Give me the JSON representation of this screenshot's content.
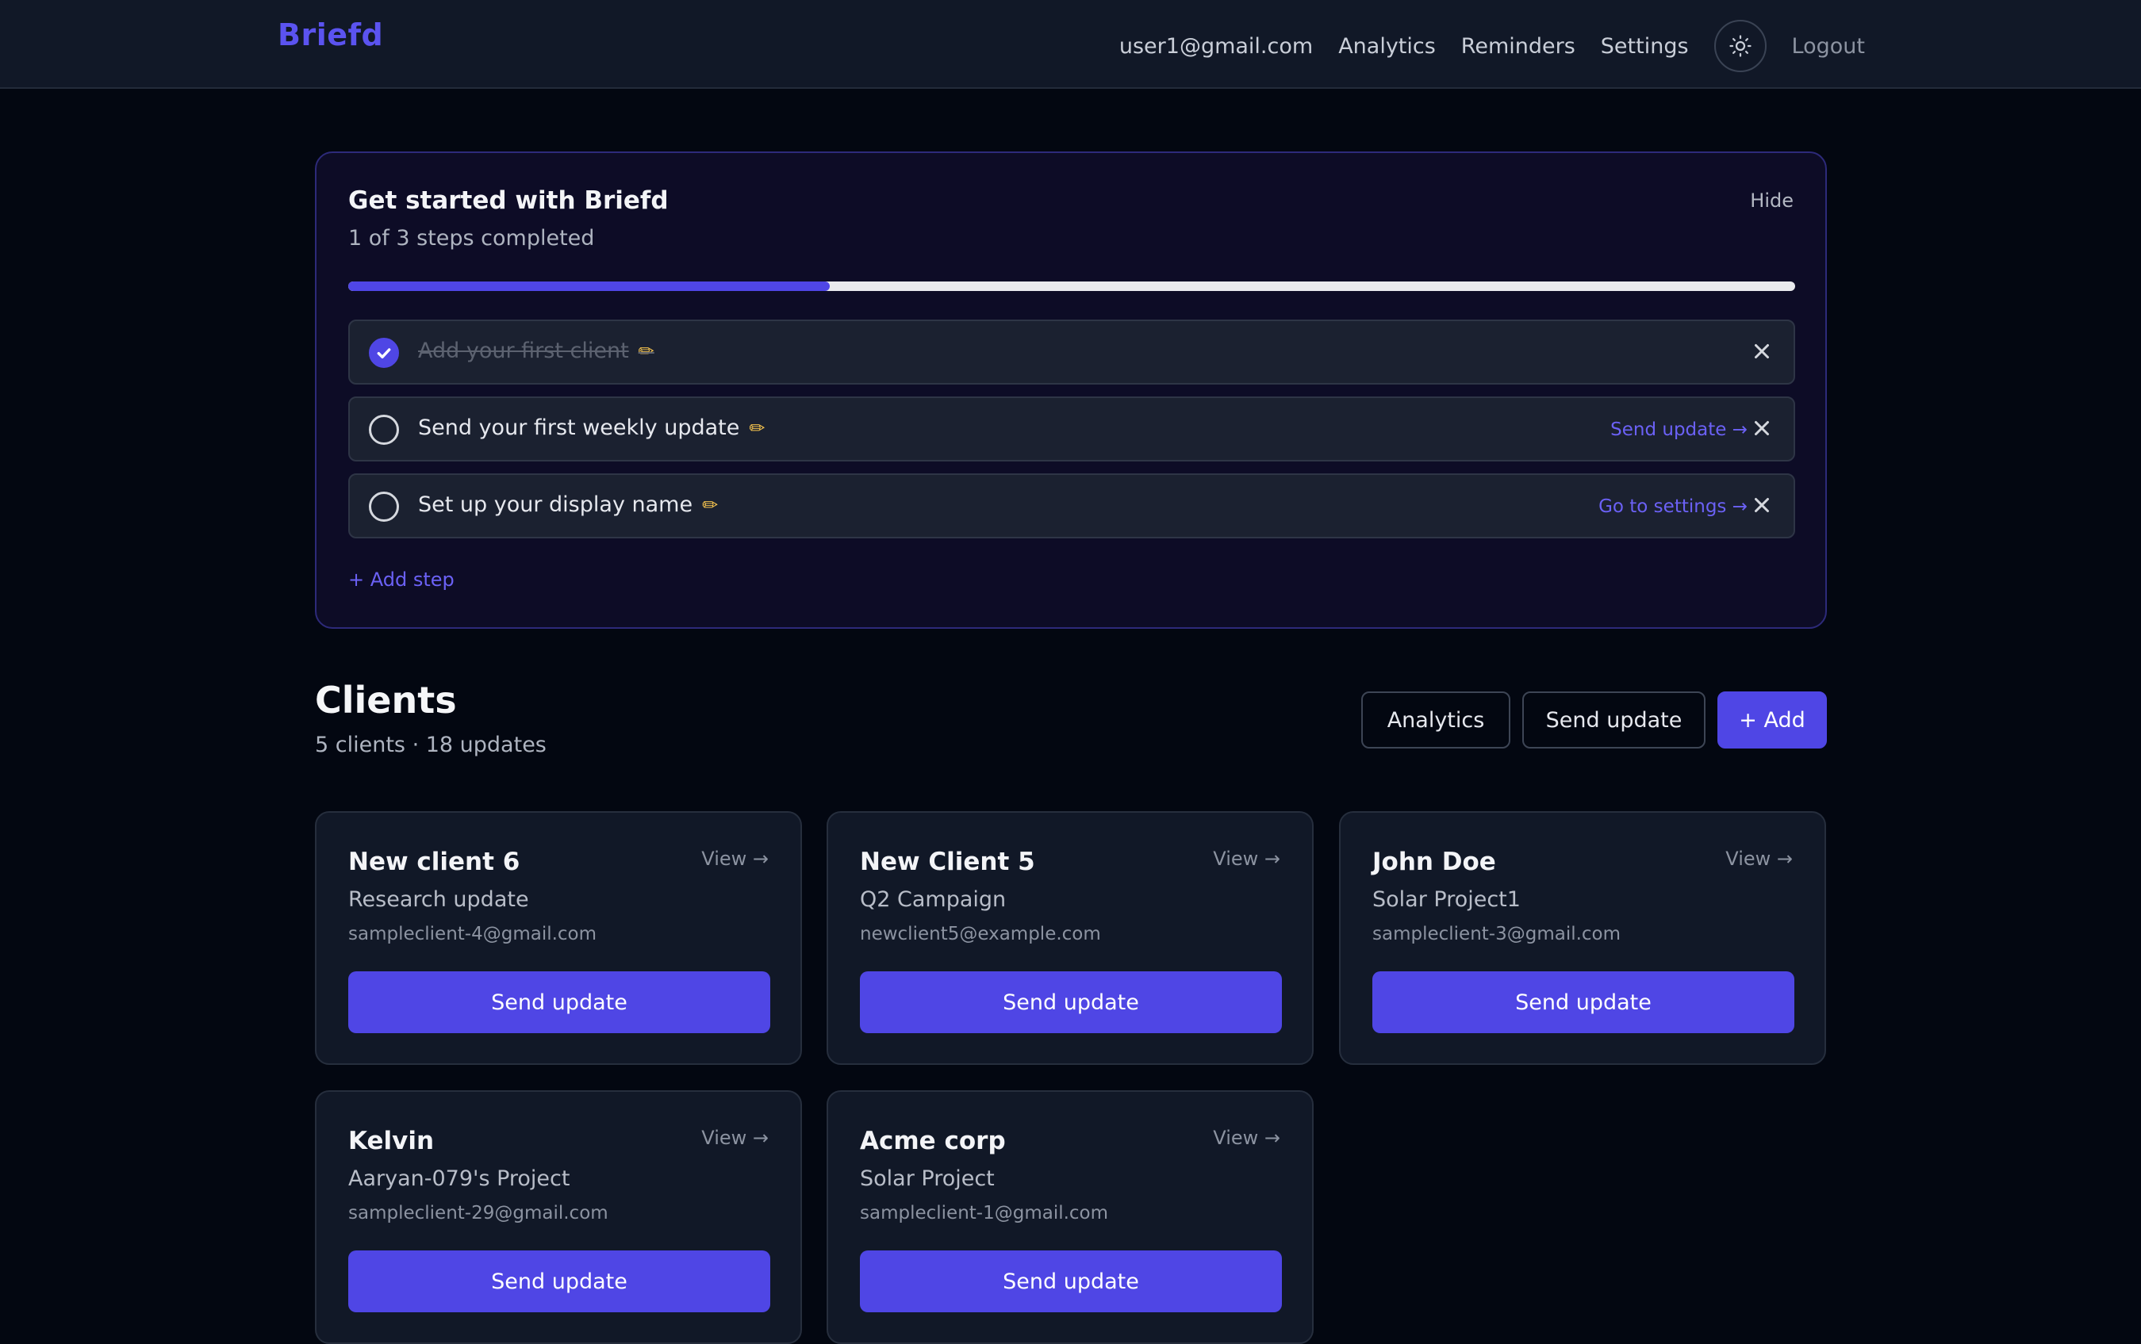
{
  "nav": {
    "brand": "Briefd",
    "email": "user1@gmail.com",
    "analytics": "Analytics",
    "reminders": "Reminders",
    "settings": "Settings",
    "theme_icon": "sun-icon",
    "logout": "Logout"
  },
  "onboarding": {
    "title": "Get started with Briefd",
    "subtitle": "1 of 3 steps completed",
    "hide": "Hide",
    "progress_fraction": 0.333,
    "steps": [
      {
        "label": "Add your first client",
        "done": true,
        "action": ""
      },
      {
        "label": "Send your first weekly update",
        "done": false,
        "action": "Send update →"
      },
      {
        "label": "Set up your display name",
        "done": false,
        "action": "Go to settings →"
      }
    ],
    "add_step": "+ Add step"
  },
  "clients": {
    "title": "Clients",
    "subtitle": "5 clients · 18 updates",
    "analytics_btn": "Analytics",
    "send_update_btn": "Send update",
    "add_btn": "+ Add",
    "view_label": "View →",
    "card_button": "Send update",
    "items": [
      {
        "name": "New client 6",
        "project": "Research update",
        "email": "sampleclient-4@gmail.com"
      },
      {
        "name": "New Client 5",
        "project": "Q2 Campaign",
        "email": "newclient5@example.com"
      },
      {
        "name": "John Doe",
        "project": "Solar Project1",
        "email": "sampleclient-3@gmail.com"
      },
      {
        "name": "Kelvin",
        "project": "Aaryan-079's Project",
        "email": "sampleclient-29@gmail.com"
      },
      {
        "name": "Acme corp",
        "project": "Solar Project",
        "email": "sampleclient-1@gmail.com"
      }
    ]
  },
  "colors": {
    "accent": "#4f46e5",
    "brand": "#5b53f0",
    "page_bg": "#030711",
    "card_bg": "#111827",
    "onboarding_bg": "#0d0c26",
    "pencil": "#f2c14e"
  }
}
